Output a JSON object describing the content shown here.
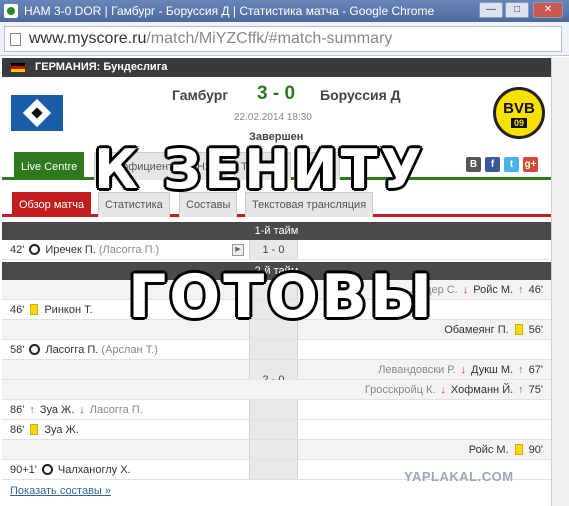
{
  "window": {
    "title": "HAM 3-0 DOR | Гамбург - Боруссия Д | Статистика матча - Google Chrome",
    "minimize_icon": "minimize-icon",
    "maximize_icon": "maximize-icon",
    "close_icon": "close-icon"
  },
  "address": {
    "url_domain": "www.myscore.ru",
    "url_path": "/match/MiYZCffk/#match-summary"
  },
  "league": {
    "label": "ГЕРМАНИЯ: Бундеслига",
    "flag_colors": [
      "#000000",
      "#dd0000",
      "#ffce00"
    ]
  },
  "match": {
    "home": "Гамбург",
    "score": "3 - 0",
    "away": "Боруссия Д",
    "datetime": "22.02.2014 18:30",
    "status": "Завершен",
    "away_logo_text": "BVB",
    "away_logo_num": "09"
  },
  "tabs_main": [
    {
      "label": "Live Centre"
    },
    {
      "label": "Коэффициенты"
    },
    {
      "label": "Н2Н"
    },
    {
      "label": "Таблица"
    },
    {
      "label": "Видео"
    }
  ],
  "social": [
    "В",
    "f",
    "t",
    "g+"
  ],
  "tabs_sub": [
    {
      "label": "Обзор матча"
    },
    {
      "label": "Статистика"
    },
    {
      "label": "Составы"
    },
    {
      "label": "Текстовая трансляция"
    }
  ],
  "first_half": {
    "header": "1-й тайм",
    "score": "1 - 0",
    "events": [
      {
        "minute": "42'",
        "player": "Иречек П.",
        "assist": "(Ласогга П.)"
      }
    ]
  },
  "second_half": {
    "header": "2-й тайм",
    "score": "2 - 0",
    "events": [
      {
        "minute": "46'",
        "player_in": "Ройс М.",
        "player_out": "...ендер С."
      },
      {
        "minute": "46'",
        "player": "Ринкон Т."
      },
      {
        "minute": "56'",
        "player": "Обамеянг П."
      },
      {
        "minute": "58'",
        "player": "Ласогга П.",
        "assist": "(Арслан Т.)"
      },
      {
        "minute": "67'",
        "player_in": "Дукш М.",
        "player_out": "Левандовски Р."
      },
      {
        "minute": "75'",
        "player_in": "Хофманн Й.",
        "player_out": "Гросскройц К."
      },
      {
        "minute": "86'",
        "player_in": "Зуа Ж.",
        "player_out": "Ласогга П."
      },
      {
        "minute": "86'",
        "player": "Зуа Ж."
      },
      {
        "minute": "90'",
        "player": "Ройс М."
      },
      {
        "minute": "90+1'",
        "player": "Чалханоглу Х."
      }
    ]
  },
  "footer": {
    "show_lineups": "Показать составы »",
    "watermark": "YAPLAKAL.COM"
  },
  "overlay": {
    "line1": "К ЗЕНИТУ",
    "line2": "ГОТОВЫ"
  },
  "colors": {
    "green": "#2f7a1f",
    "red": "#c21d1d",
    "yellow_card": "#f5d90a"
  }
}
